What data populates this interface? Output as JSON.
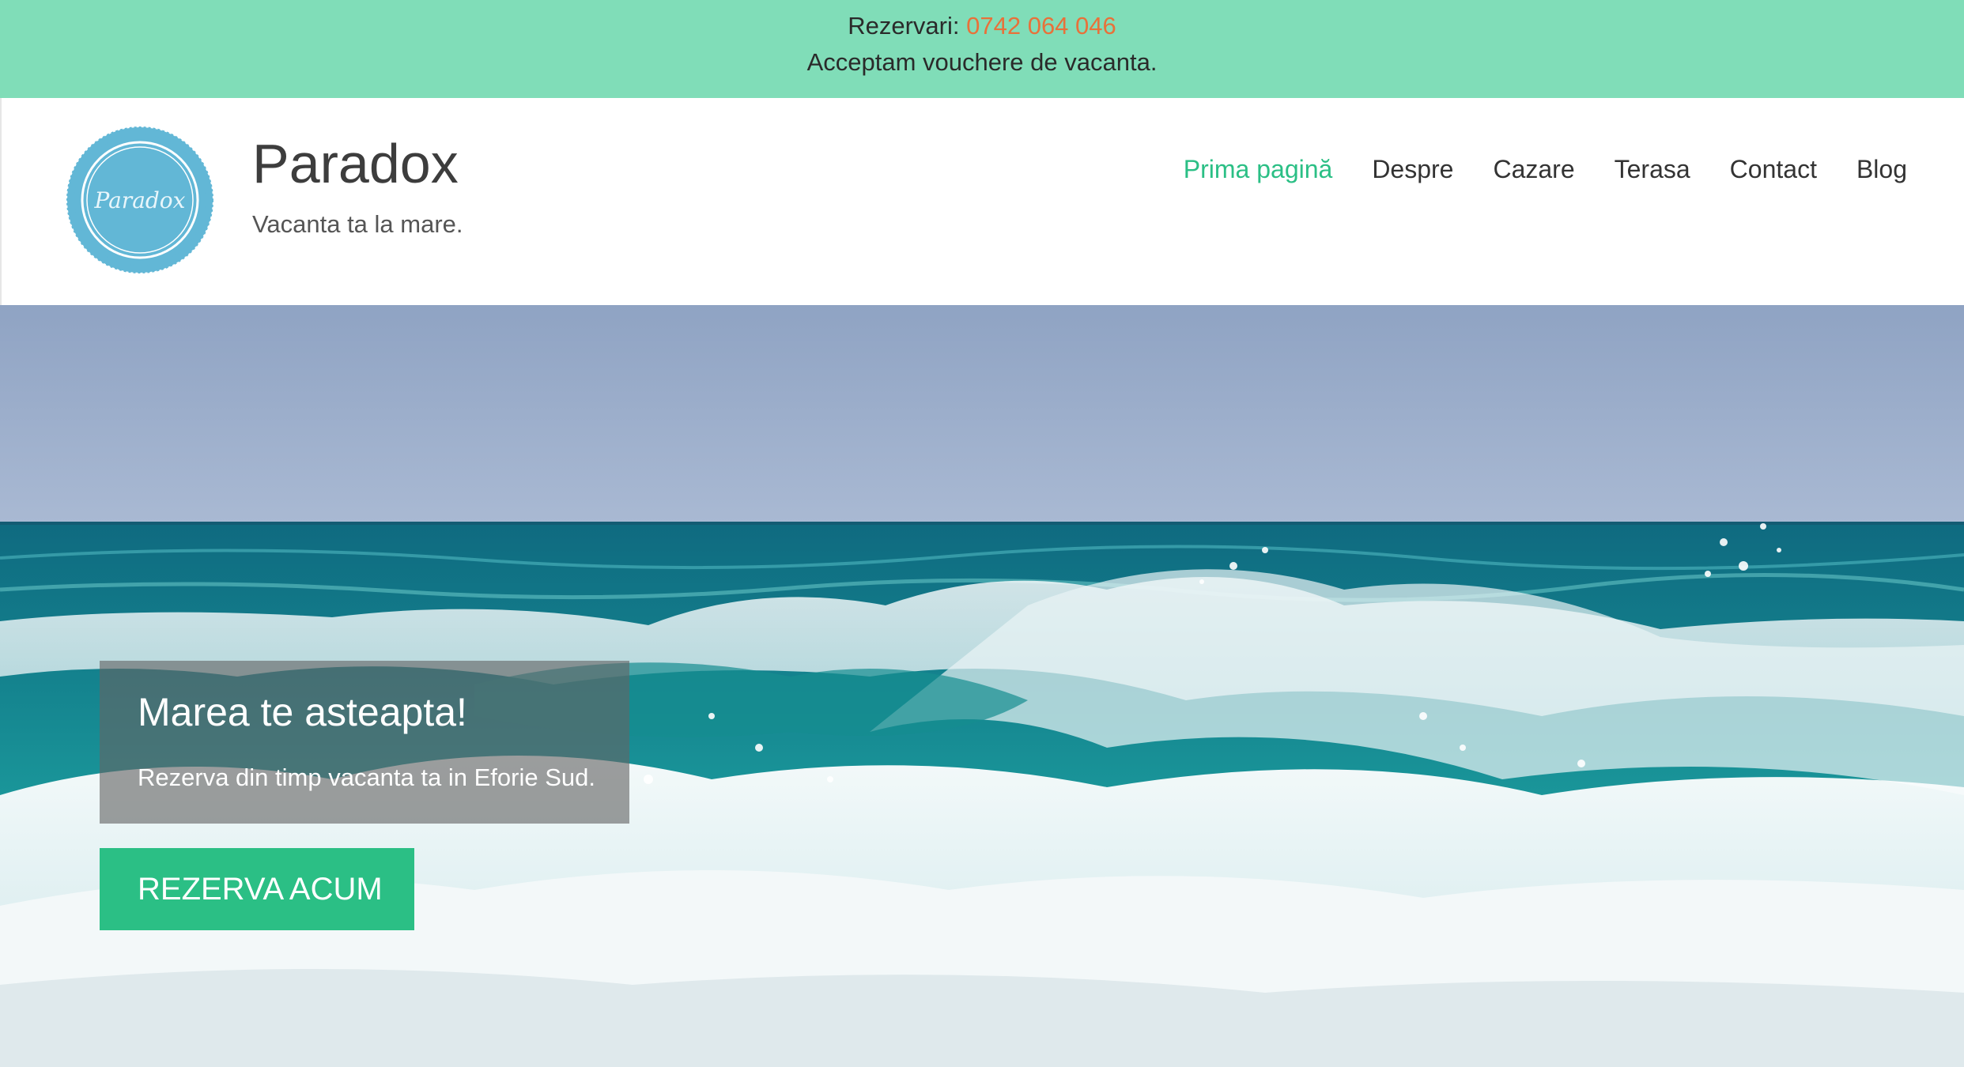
{
  "topbar": {
    "reservations_label": "Rezervari:",
    "phone": "0742 064 046",
    "voucher_text": "Acceptam vouchere de vacanta."
  },
  "site": {
    "logo_text": "Paradox",
    "title": "Paradox",
    "tagline": "Vacanta ta la mare."
  },
  "nav": {
    "items": [
      "Prima pagină",
      "Despre",
      "Cazare",
      "Terasa",
      "Contact",
      "Blog"
    ],
    "active_index": 0
  },
  "hero": {
    "title": "Marea te asteapta!",
    "subtitle": "Rezerva din timp vacanta ta in Eforie Sud.",
    "cta_label": "REZERVA ACUM"
  },
  "colors": {
    "topbar_bg": "#80ddb8",
    "phone": "#e8713a",
    "accent": "#2bbf85",
    "logo_blue": "#62b7d6"
  }
}
